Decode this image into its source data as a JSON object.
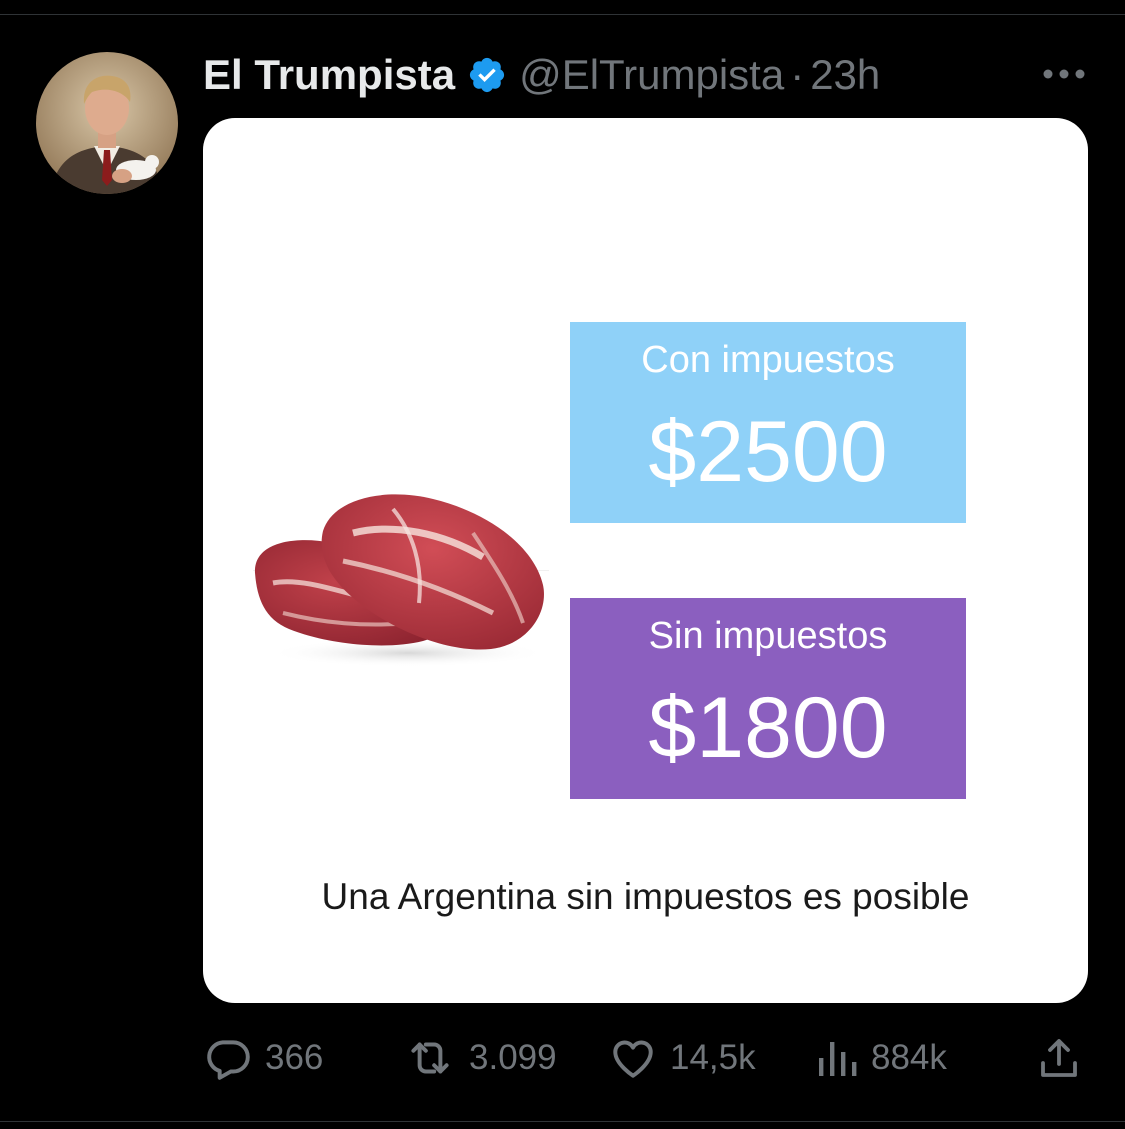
{
  "tweet": {
    "display_name": "El Trumpista",
    "handle": "@ElTrumpista",
    "separator": "·",
    "time": "23h",
    "verified": true
  },
  "media": {
    "with_tax_label": "Con impuestos",
    "with_tax_price": "$2500",
    "without_tax_label": "Sin impuestos",
    "without_tax_price": "$1800",
    "caption": "Una Argentina sin impuestos es posible",
    "colors": {
      "with_tax_bg": "#8fd1f8",
      "without_tax_bg": "#8b5fbf"
    }
  },
  "actions": {
    "replies": "366",
    "reposts": "3.099",
    "likes": "14,5k",
    "views": "884k"
  },
  "icons": {
    "verified": "verified-badge-icon",
    "more": "more-icon",
    "reply": "reply-icon",
    "repost": "repost-icon",
    "like": "heart-icon",
    "views": "views-icon",
    "share": "share-icon"
  },
  "colors": {
    "background": "#000000",
    "text_primary": "#e7e9ea",
    "text_secondary": "#71767b",
    "verified_blue": "#1d9bf0"
  }
}
